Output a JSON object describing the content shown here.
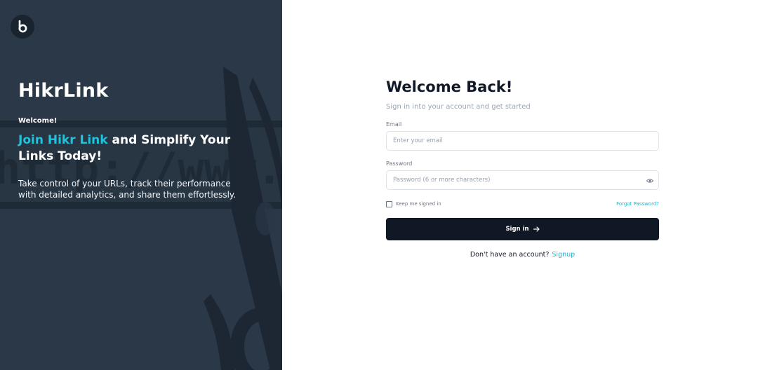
{
  "brand": {
    "logo_letter": "b",
    "logo_icon": "brand-logo-icon",
    "accent_color": "#20c3dc",
    "dark_color": "#101826",
    "panel_color": "#2b3848"
  },
  "hero": {
    "background_watermark": "http://www.",
    "title": "HikrLink",
    "welcome": "Welcome!",
    "headline_accent": "Join Hikr Link",
    "headline_rest": " and Simplify Your Links Today!",
    "description": "Take control of your URLs, track their performance with detailed analytics, and share them effortlessly."
  },
  "login": {
    "title": "Welcome Back!",
    "subtitle": "Sign in into your account and get started",
    "email_label": "Email",
    "email_placeholder": "Enter your email",
    "email_value": "",
    "password_label": "Password",
    "password_placeholder": "Password (6 or more characters)",
    "password_value": "",
    "password_toggle_icon": "eye-icon",
    "remember_label": "Keep me signed in",
    "remember_checked": false,
    "forgot_label": "Forgot Password?",
    "signin_label": "Sign in",
    "signin_icon": "arrow-right-icon",
    "signup_prompt": "Don't have an account?",
    "signup_label": "Signup"
  }
}
